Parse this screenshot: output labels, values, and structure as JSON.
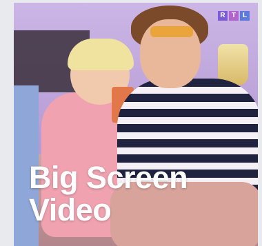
{
  "card": {
    "logo_letters": [
      "R",
      "T",
      "L"
    ],
    "headline_line1": "Big Screen",
    "headline_line2": "Video"
  },
  "colors": {
    "logo_r": "#7c5cd6",
    "logo_t": "#b163ce",
    "logo_l": "#5c79db",
    "text": "#ffffff",
    "background": "#e9eaee"
  }
}
